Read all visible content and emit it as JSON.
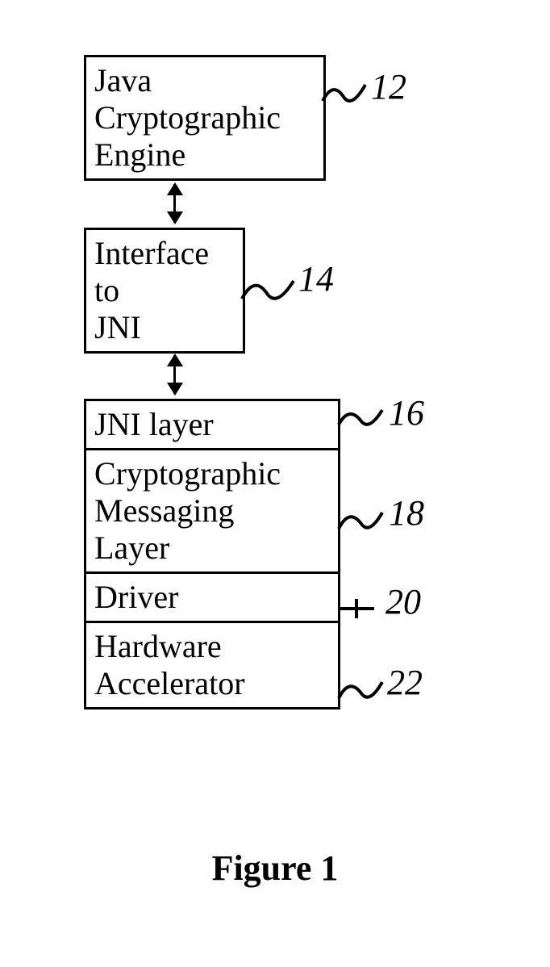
{
  "boxes": {
    "jce": "Java\nCryptographic\nEngine",
    "iface": "Interface\nto\nJNI"
  },
  "stack": {
    "jni": "JNI layer",
    "cml": "Cryptographic\nMessaging\nLayer",
    "driver": "Driver",
    "hw": "Hardware\nAccelerator"
  },
  "refs": {
    "r12": "12",
    "r14": "14",
    "r16": "16",
    "r18": "18",
    "r20": "20",
    "r22": "22"
  },
  "caption": "Figure 1"
}
